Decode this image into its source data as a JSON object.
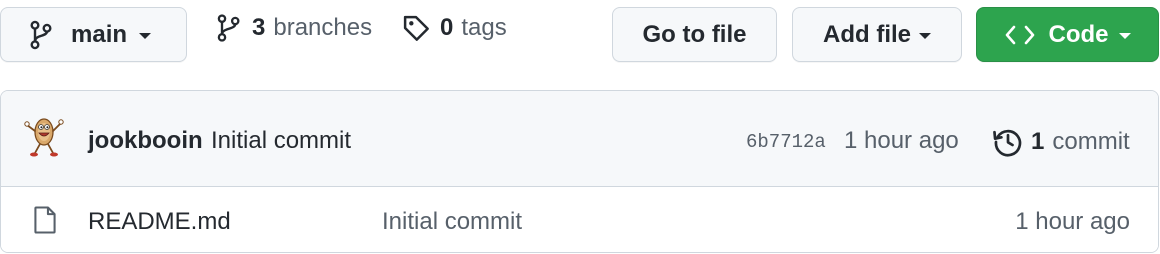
{
  "toolbar": {
    "branch_name": "main",
    "branch_icon": "git-branch-icon",
    "branches_count": "3",
    "branches_label": "branches",
    "tags_count": "0",
    "tags_label": "tags",
    "tag_icon": "tag-icon",
    "goto_file_label": "Go to file",
    "add_file_label": "Add file",
    "code_label": "Code",
    "code_icon": "code-brackets-icon"
  },
  "latest_commit": {
    "avatar": "peanut-avatar",
    "author": "jookbooin",
    "message": "Initial commit",
    "sha": "6b7712a",
    "time": "1 hour ago",
    "history_icon": "history-icon",
    "commit_count": "1",
    "commit_label": "commit"
  },
  "files": [
    {
      "icon": "file-icon",
      "name": "README.md",
      "message": "Initial commit",
      "time": "1 hour ago"
    }
  ],
  "colors": {
    "primary_green": "#2da44e",
    "border": "#d0d7de",
    "muted_text": "#57606a",
    "row_bg": "#f6f8fa"
  }
}
